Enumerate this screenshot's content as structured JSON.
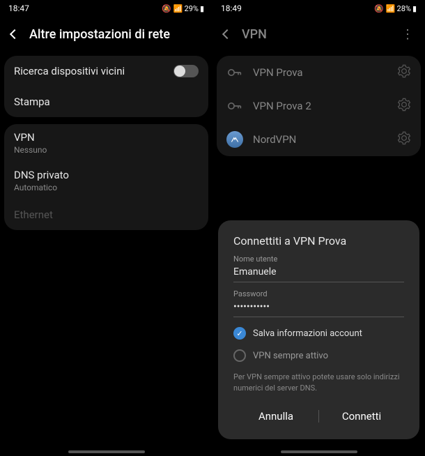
{
  "left": {
    "status": {
      "time": "18:47",
      "battery": "29%",
      "icons": "🔊🔕📶🔋▮"
    },
    "header": {
      "title": "Altre impostazioni di rete"
    },
    "section1": {
      "nearby": {
        "title": "Ricerca dispositivi vicini"
      },
      "print": {
        "title": "Stampa"
      }
    },
    "section2": {
      "vpn": {
        "title": "VPN",
        "sub": "Nessuno"
      },
      "dns": {
        "title": "DNS privato",
        "sub": "Automatico"
      },
      "ethernet": {
        "title": "Ethernet"
      }
    }
  },
  "right": {
    "status": {
      "time": "18:49",
      "battery": "28%",
      "icons": "🔊🔕📶🔋▮"
    },
    "header": {
      "title": "VPN"
    },
    "vpns": [
      {
        "name": "VPN Prova"
      },
      {
        "name": "VPN Prova 2"
      },
      {
        "name": "NordVPN"
      }
    ],
    "dialog": {
      "title": "Connettiti a VPN Prova",
      "username_label": "Nome utente",
      "username_value": "Emanuele",
      "password_label": "Password",
      "password_value": "•••••••••••",
      "save_label": "Salva informazioni account",
      "always_label": "VPN sempre attivo",
      "hint": "Per VPN sempre attivo potete usare solo indirizzi numerici del server DNS.",
      "cancel": "Annulla",
      "connect": "Connetti"
    }
  }
}
